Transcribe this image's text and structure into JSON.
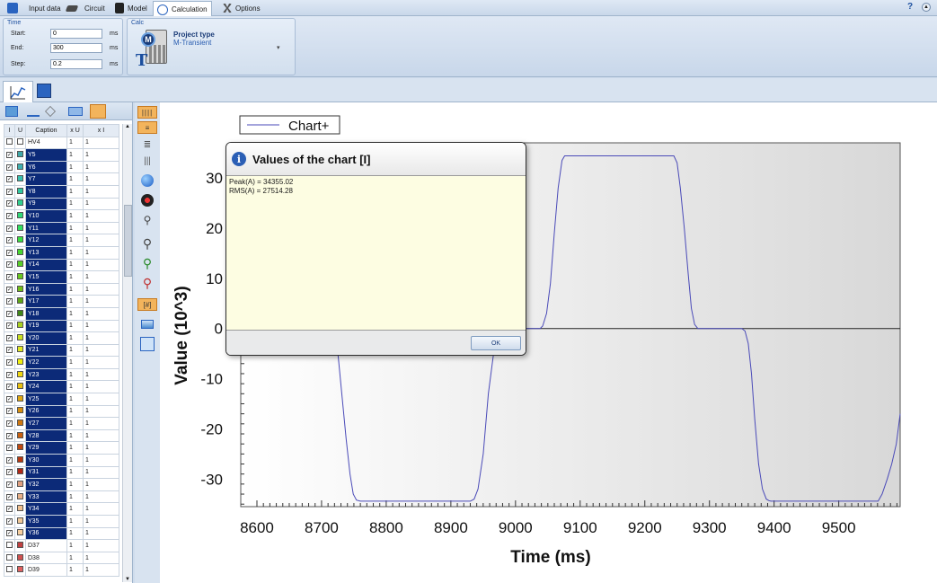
{
  "menu": {
    "tabs": [
      {
        "label": "Input data",
        "icon": "input-data-icon"
      },
      {
        "label": "Circuit",
        "icon": "circuit-icon"
      },
      {
        "label": "Model",
        "icon": "model-icon"
      },
      {
        "label": "Calculation",
        "icon": "calculation-icon",
        "active": true
      },
      {
        "label": "Options",
        "icon": "options-icon"
      }
    ],
    "help": "?"
  },
  "ribbon": {
    "time": {
      "title": "Time",
      "start_label": "Start:",
      "start_value": "0",
      "start_unit": "ms",
      "end_label": "End:",
      "end_value": "300",
      "end_unit": "ms",
      "step_label": "Step:",
      "step_value": "0.2",
      "step_unit": "ms"
    },
    "calc": {
      "title": "Calc",
      "project_type_label": "Project type",
      "project_type_value": "M-Transient"
    }
  },
  "signals": {
    "headers": [
      "I",
      "U",
      "Caption",
      "x U",
      "x I"
    ],
    "rows": [
      {
        "caption": "HV4",
        "i": false,
        "u": false,
        "xu": "1",
        "xi": "1",
        "color": "#ffffff",
        "sel": false
      },
      {
        "caption": "Y5",
        "i": true,
        "u": false,
        "xu": "1",
        "xi": "1",
        "color": "#3fa8a8",
        "sel": true
      },
      {
        "caption": "Y6",
        "i": true,
        "u": false,
        "xu": "1",
        "xi": "1",
        "color": "#3fb0b0",
        "sel": true
      },
      {
        "caption": "Y7",
        "i": true,
        "u": false,
        "xu": "1",
        "xi": "1",
        "color": "#38c0b0",
        "sel": true
      },
      {
        "caption": "Y8",
        "i": true,
        "u": false,
        "xu": "1",
        "xi": "1",
        "color": "#30c8a0",
        "sel": true
      },
      {
        "caption": "Y9",
        "i": true,
        "u": false,
        "xu": "1",
        "xi": "1",
        "color": "#30d090",
        "sel": true
      },
      {
        "caption": "Y10",
        "i": true,
        "u": false,
        "xu": "1",
        "xi": "1",
        "color": "#30d878",
        "sel": true
      },
      {
        "caption": "Y11",
        "i": true,
        "u": false,
        "xu": "1",
        "xi": "1",
        "color": "#30e060",
        "sel": true
      },
      {
        "caption": "Y12",
        "i": true,
        "u": false,
        "xu": "1",
        "xi": "1",
        "color": "#38e040",
        "sel": true
      },
      {
        "caption": "Y13",
        "i": true,
        "u": false,
        "xu": "1",
        "xi": "1",
        "color": "#48d830",
        "sel": true
      },
      {
        "caption": "Y14",
        "i": true,
        "u": false,
        "xu": "1",
        "xi": "1",
        "color": "#58d028",
        "sel": true
      },
      {
        "caption": "Y15",
        "i": true,
        "u": false,
        "xu": "1",
        "xi": "1",
        "color": "#68c820",
        "sel": true
      },
      {
        "caption": "Y16",
        "i": true,
        "u": false,
        "xu": "1",
        "xi": "1",
        "color": "#70c018",
        "sel": true
      },
      {
        "caption": "Y17",
        "i": true,
        "u": false,
        "xu": "1",
        "xi": "1",
        "color": "#60a818",
        "sel": true
      },
      {
        "caption": "Y18",
        "i": true,
        "u": false,
        "xu": "1",
        "xi": "1",
        "color": "#408818",
        "sel": true
      },
      {
        "caption": "Y19",
        "i": true,
        "u": false,
        "xu": "1",
        "xi": "1",
        "color": "#a8d020",
        "sel": true
      },
      {
        "caption": "Y20",
        "i": true,
        "u": false,
        "xu": "1",
        "xi": "1",
        "color": "#c8e020",
        "sel": true
      },
      {
        "caption": "Y21",
        "i": true,
        "u": false,
        "xu": "1",
        "xi": "1",
        "color": "#e0e820",
        "sel": true
      },
      {
        "caption": "Y22",
        "i": true,
        "u": false,
        "xu": "1",
        "xi": "1",
        "color": "#f0f010",
        "sel": true
      },
      {
        "caption": "Y23",
        "i": true,
        "u": false,
        "xu": "1",
        "xi": "1",
        "color": "#f0d810",
        "sel": true
      },
      {
        "caption": "Y24",
        "i": true,
        "u": false,
        "xu": "1",
        "xi": "1",
        "color": "#e8c010",
        "sel": true
      },
      {
        "caption": "Y25",
        "i": true,
        "u": false,
        "xu": "1",
        "xi": "1",
        "color": "#e0a810",
        "sel": true
      },
      {
        "caption": "Y26",
        "i": true,
        "u": false,
        "xu": "1",
        "xi": "1",
        "color": "#d89010",
        "sel": true
      },
      {
        "caption": "Y27",
        "i": true,
        "u": false,
        "xu": "1",
        "xi": "1",
        "color": "#d07810",
        "sel": true
      },
      {
        "caption": "Y28",
        "i": true,
        "u": false,
        "xu": "1",
        "xi": "1",
        "color": "#c86010",
        "sel": true
      },
      {
        "caption": "Y29",
        "i": true,
        "u": false,
        "xu": "1",
        "xi": "1",
        "color": "#c04810",
        "sel": true
      },
      {
        "caption": "Y30",
        "i": true,
        "u": false,
        "xu": "1",
        "xi": "1",
        "color": "#b83810",
        "sel": true
      },
      {
        "caption": "Y31",
        "i": true,
        "u": false,
        "xu": "1",
        "xi": "1",
        "color": "#b02818",
        "sel": true
      },
      {
        "caption": "Y32",
        "i": true,
        "u": false,
        "xu": "1",
        "xi": "1",
        "color": "#e0a080",
        "sel": true
      },
      {
        "caption": "Y33",
        "i": true,
        "u": false,
        "xu": "1",
        "xi": "1",
        "color": "#e8b088",
        "sel": true
      },
      {
        "caption": "Y34",
        "i": true,
        "u": false,
        "xu": "1",
        "xi": "1",
        "color": "#f0c090",
        "sel": true
      },
      {
        "caption": "Y35",
        "i": true,
        "u": false,
        "xu": "1",
        "xi": "1",
        "color": "#f0c898",
        "sel": true
      },
      {
        "caption": "Y36",
        "i": true,
        "u": false,
        "xu": "1",
        "xi": "1",
        "color": "#f8d0a0",
        "sel": true
      },
      {
        "caption": "D37",
        "i": false,
        "u": false,
        "xu": "1",
        "xi": "1",
        "color": "#c04040",
        "sel": false
      },
      {
        "caption": "D38",
        "i": false,
        "u": false,
        "xu": "1",
        "xi": "1",
        "color": "#d05050",
        "sel": false
      },
      {
        "caption": "D39",
        "i": false,
        "u": false,
        "xu": "1",
        "xi": "1",
        "color": "#e06060",
        "sel": false
      }
    ]
  },
  "chart_data": {
    "type": "line",
    "title": "",
    "xlabel": "Time (ms)",
    "ylabel": "Value (10^3)",
    "xlim": [
      8575,
      9595
    ],
    "ylim": [
      -35.5,
      37
    ],
    "xticks": [
      8600,
      8700,
      8800,
      8900,
      9000,
      9100,
      9200,
      9300,
      9400,
      9500
    ],
    "yticks": [
      30,
      20,
      10,
      0,
      -10,
      -20,
      -30
    ],
    "legend": "top-left",
    "grid": false,
    "series": [
      {
        "name": "Chart+",
        "color": "#4a4ab8",
        "x": [
          8716,
          8721,
          8726,
          8732,
          8738,
          8744,
          8749,
          8754,
          8760,
          8930,
          8936,
          8942,
          8950,
          8958,
          8966,
          8975,
          8985,
          9000,
          9025,
          9038,
          9042,
          9048,
          9054,
          9060,
          9066,
          9072,
          9076,
          9245,
          9250,
          9255,
          9261,
          9267,
          9272,
          9277,
          9282,
          9287,
          9291,
          9350,
          9355,
          9360,
          9365,
          9370,
          9376,
          9382,
          9388,
          9392,
          9395,
          9561,
          9567,
          9575,
          9582,
          9589,
          9595
        ],
        "y": [
          6,
          0,
          -6,
          -14,
          -22,
          -29,
          -33,
          -34.2,
          -34.4,
          -34.4,
          -34,
          -32,
          -25,
          -13,
          -5,
          -2,
          -0.5,
          0,
          0,
          0,
          0.5,
          3,
          9,
          19,
          28,
          33.5,
          34.4,
          34.4,
          33,
          28,
          20,
          11,
          4,
          0.8,
          0,
          0,
          0,
          0,
          -0.5,
          -3,
          -9,
          -18,
          -27,
          -32,
          -34,
          -34.3,
          -34.4,
          -34.4,
          -33,
          -30,
          -27,
          -23,
          -17
        ]
      }
    ]
  },
  "dialog": {
    "title": "Values of the chart [I]",
    "lines": [
      "Peak(A) = 34355.02",
      "RMS(A) = 27514.28"
    ],
    "ok_label": "OK"
  }
}
